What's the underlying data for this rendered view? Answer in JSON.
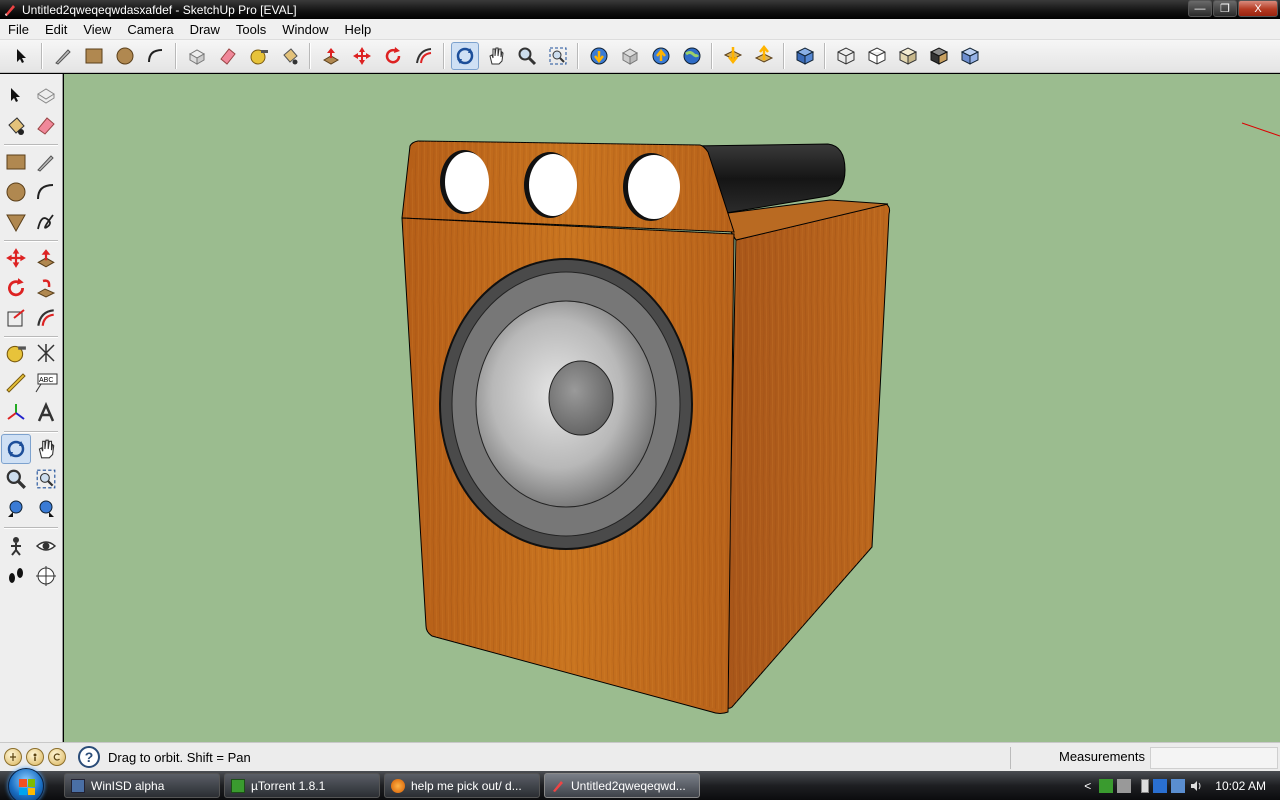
{
  "window": {
    "title": "Untitled2qweqeqwdasxafdef - SketchUp Pro [EVAL]",
    "minimize_label": "—",
    "maximize_label": "❐",
    "close_label": "X"
  },
  "menu": [
    "File",
    "Edit",
    "View",
    "Camera",
    "Draw",
    "Tools",
    "Window",
    "Help"
  ],
  "status": {
    "message": "Drag to orbit.  Shift = Pan",
    "measurements_label": "Measurements",
    "measurements_value": "",
    "help_glyph": "?"
  },
  "text_tool_label": "ABC",
  "taskbar": {
    "tasks": [
      {
        "label": "WinISD alpha"
      },
      {
        "label": "µTorrent 1.8.1"
      },
      {
        "label": "help me pick out/ d..."
      },
      {
        "label": "Untitled2qweqeqwd..."
      }
    ],
    "clock": "10:02 AM",
    "tray_arrow": "<"
  },
  "colors": {
    "viewport_bg": "#9bbc8f",
    "wood": "#c0671c",
    "port_tube": "#1a1a1a"
  }
}
